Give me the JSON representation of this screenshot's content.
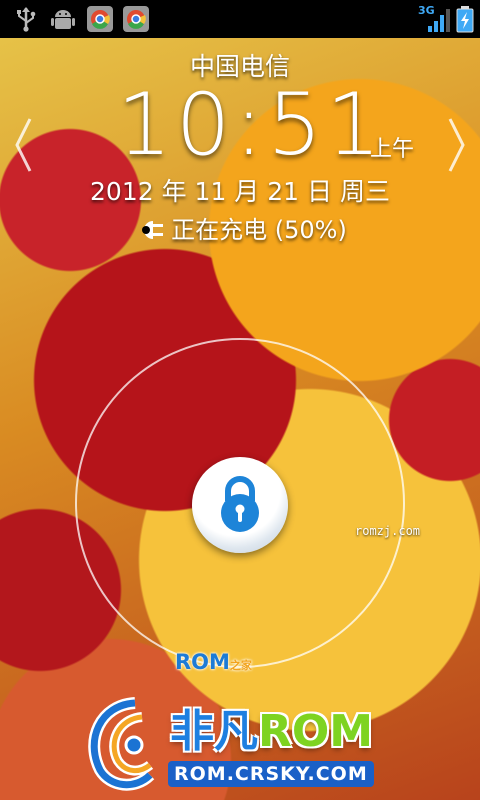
{
  "status_bar": {
    "left_icons": [
      "usb-icon",
      "android-debug-icon",
      "chrome-app-icon",
      "chrome-app-icon"
    ],
    "network_label": "3G",
    "right_icons": [
      "signal-icon",
      "battery-charging-icon"
    ]
  },
  "lockscreen": {
    "carrier": "中国电信",
    "time": "10:51",
    "ampm": "上午",
    "date": "2012 年 11 月 21 日 周三",
    "charging_text": "正在充电 (50%)",
    "battery_percent": 50
  },
  "watermarks": {
    "small": "romzj.com",
    "rom_logo_main": "ROM",
    "rom_logo_sub": "之家",
    "brand_part1": "非凡",
    "brand_part2": "ROM",
    "brand_url": "ROM.CRSKY.COM"
  },
  "colors": {
    "status_bar_bg": "#000000",
    "accent_blue": "#1e7fe0",
    "brand_green": "#7ed321"
  }
}
